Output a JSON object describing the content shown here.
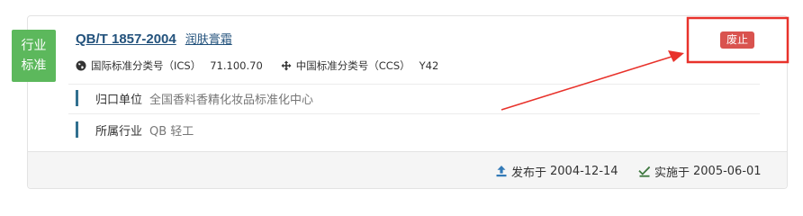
{
  "badge": {
    "line1": "行业",
    "line2": "标准",
    "color": "#5cb85c"
  },
  "standard": {
    "code": "QB/T 1857-2004",
    "name": "润肤膏霜"
  },
  "classification": {
    "ics_label": "国际标准分类号（ICS）",
    "ics_value": "71.100.70",
    "ccs_label": "中国标准分类号（CCS）",
    "ccs_value": "Y42",
    "ics_icon": "globe-icon",
    "ccs_icon": "move-arrows-icon"
  },
  "info": [
    {
      "label": "归口单位",
      "value": "全国香料香精化妆品标准化中心"
    },
    {
      "label": "所属行业",
      "value": "QB 轻工"
    }
  ],
  "status": {
    "text": "废止",
    "color": "#d9534f"
  },
  "dates": {
    "publish_label": "发布于",
    "publish_date": "2004-12-14",
    "publish_icon": "upload-icon",
    "implement_label": "实施于",
    "implement_date": "2005-06-01",
    "implement_icon": "check-icon"
  },
  "annotation": {
    "color": "#e8322b"
  }
}
